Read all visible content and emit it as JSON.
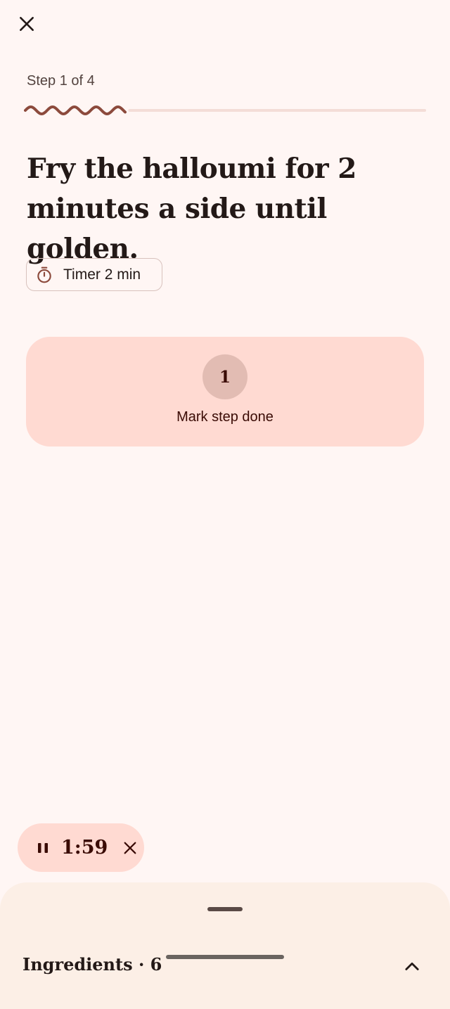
{
  "header": {
    "close_icon": "close-icon",
    "step_label": "Step 1 of 4",
    "progress_fraction": 0.25
  },
  "step": {
    "instruction": "Fry the halloumi for 2 minutes a side until golden."
  },
  "timer_chip": {
    "icon": "stopwatch-icon",
    "label": "Timer 2 min"
  },
  "done_card": {
    "step_number": "1",
    "label": "Mark step done"
  },
  "active_timer": {
    "pause_icon": "pause-icon",
    "time_left": "1:59",
    "dismiss_icon": "close-icon"
  },
  "sheet": {
    "title": "Ingredients · 6",
    "expand_icon": "chevron-up-icon"
  },
  "colors": {
    "background": "#fff6f4",
    "accent": "#8c4a3c",
    "card": "#ffdad2",
    "sheet": "#fcefe6"
  }
}
